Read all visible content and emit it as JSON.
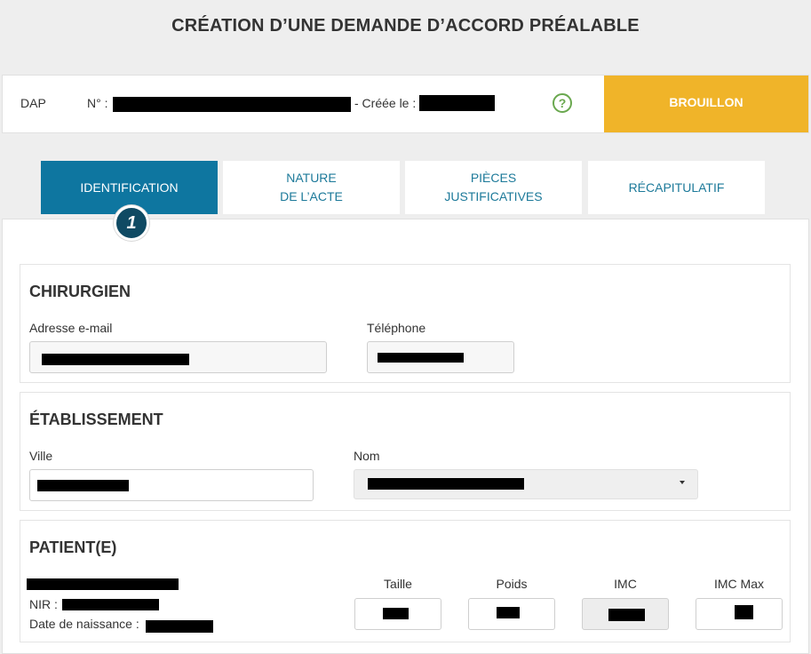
{
  "page": {
    "title": "CRÉATION D’UNE DEMANDE D’ACCORD PRÉALABLE"
  },
  "header": {
    "dap_label": "DAP",
    "number_label": "N° :",
    "created_label": "- Créée le :",
    "help_icon": "?",
    "status": "BROUILLON"
  },
  "tabs": [
    {
      "label": "IDENTIFICATION",
      "active": true
    },
    {
      "label": "NATURE\nDE L’ACTE",
      "active": false
    },
    {
      "label": "PIÈCES\nJUSTIFICATIVES",
      "active": false
    },
    {
      "label": "RÉCAPITULATIF",
      "active": false
    }
  ],
  "step_indicator": "1",
  "sections": {
    "chirurgien": {
      "title": "CHIRURGIEN",
      "email_label": "Adresse e-mail",
      "phone_label": "Téléphone"
    },
    "etablissement": {
      "title": "ÉTABLISSEMENT",
      "city_label": "Ville",
      "name_label": "Nom"
    },
    "patient": {
      "title": "PATIENT(E)",
      "nir_label": "NIR :",
      "birth_label": "Date de naissance :",
      "height_label": "Taille",
      "weight_label": "Poids",
      "bmi_label": "IMC",
      "bmi_max_label": "IMC Max"
    }
  },
  "colors": {
    "active_tab": "#0e76a0",
    "tab_text": "#1d7a9a",
    "status_badge": "#f0b429",
    "help_icon": "#6aa84f",
    "step_circle": "#0f4a63"
  }
}
